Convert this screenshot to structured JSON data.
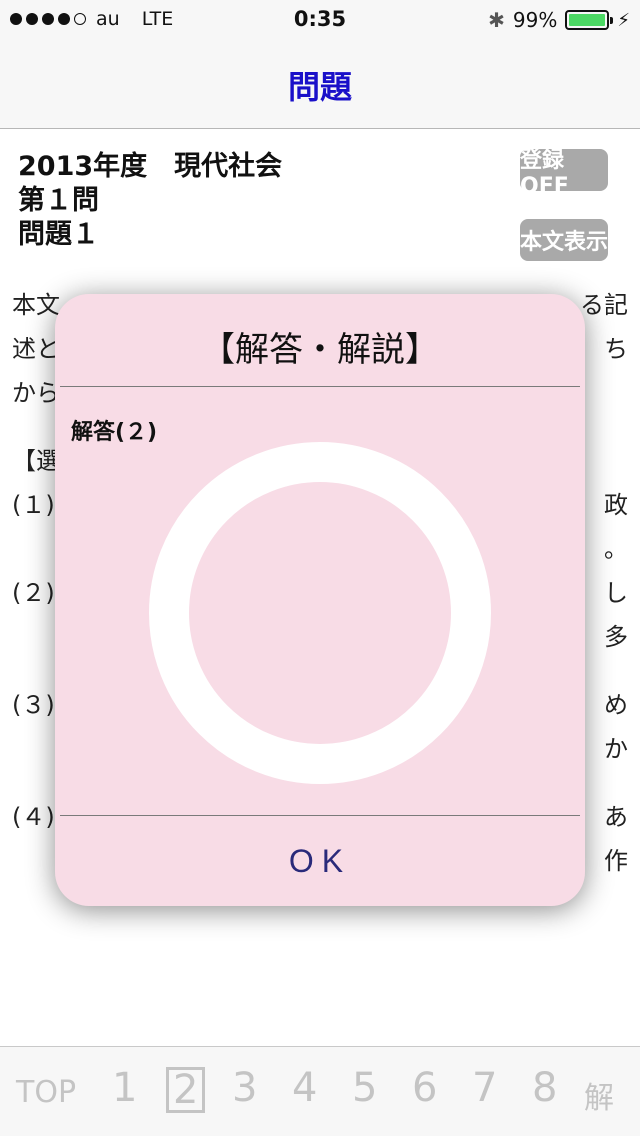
{
  "status_bar": {
    "carrier": "au",
    "network": "LTE",
    "time": "0:35",
    "battery_percent": "99%",
    "battery_level": 0.99,
    "battery_color": "#4cd964"
  },
  "nav": {
    "title": "問題"
  },
  "question": {
    "year_subject": "2013年度　現代社会",
    "section": "第１問",
    "problem": "問題１"
  },
  "buttons": {
    "register": "登録 OFF",
    "show_text": "本文表示"
  },
  "body_fragments": {
    "line1_left": "本文",
    "line1_right": "る記",
    "line2_left": "述と",
    "line2_right": "ち",
    "line3_left": "から",
    "choices_head": "【選",
    "c1_left": "(１)",
    "c1_right": "政",
    "c1_right2": "。",
    "c2_left": "(２)",
    "c2_right": "し",
    "c2_right2": "多",
    "c3_left": "(３)",
    "c3_right": "め",
    "c3_right2": "か",
    "c4_left": "(４)",
    "c4_right": "あ",
    "c4_right2": "作"
  },
  "modal": {
    "title": "【解答・解説】",
    "answer": "解答(２)",
    "mark_icon": "circle-correct-icon",
    "ok": "OK"
  },
  "toolbar": {
    "top": "TOP",
    "items": [
      "1",
      "2",
      "3",
      "4",
      "5",
      "6",
      "7",
      "8",
      "解"
    ],
    "current": "2"
  }
}
